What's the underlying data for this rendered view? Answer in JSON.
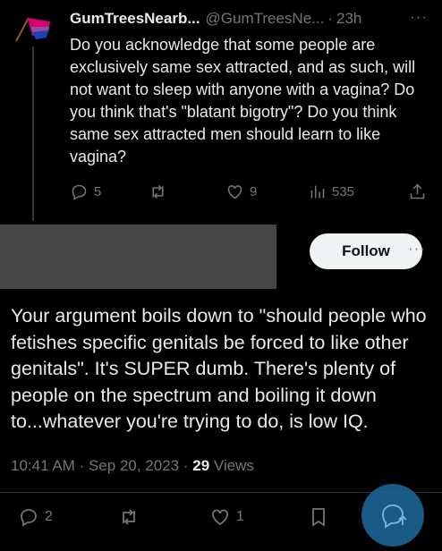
{
  "reply": {
    "display_name": "GumTreesNearb...",
    "username": "@GumTreesNe...",
    "separator": "·",
    "time": "23h",
    "more": "···",
    "text": "Do you acknowledge that some people are exclusively same sex attracted, and as such, will not want to sleep with anyone with a vagina? Do you think that's \"blatant bigotry\"? Do you think same sex attracted men should learn to like vagina?",
    "stats": {
      "replies": "5",
      "likes": "9",
      "views": "535"
    }
  },
  "tweet": {
    "follow_label": "Follow",
    "more": "···",
    "text": "Your argument boils down to \"should people who fetishes specific genitals be forced to like other genitals\". It's SUPER dumb. There's plenty of people on the spectrum and boiling it down to...whatever you're trying to do, is low IQ.",
    "time": "10:41 AM",
    "date": "Sep 20, 2023",
    "sep1": "·",
    "sep2": "·",
    "views_count": "29",
    "views_label": " Views",
    "stats": {
      "replies": "2",
      "likes": "1"
    }
  },
  "colors": {
    "muted": "#71767b",
    "text": "#e7e9ea",
    "fab": "#1d9bf0"
  },
  "icons": [
    "reply-icon",
    "retweet-icon",
    "like-icon",
    "views-icon",
    "share-icon",
    "bookmark-icon",
    "compose-icon"
  ]
}
